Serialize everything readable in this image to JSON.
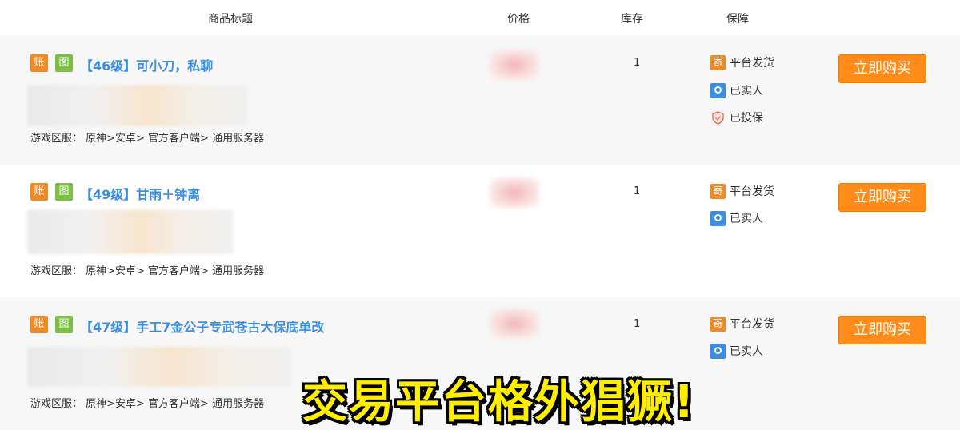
{
  "header": {
    "title": "商品标题",
    "price": "价格",
    "stock": "库存",
    "guarantee": "保障"
  },
  "tags": {
    "account": "账",
    "image": "图"
  },
  "listings": [
    {
      "title": "【46级】可小刀，私聊",
      "region": "游戏区服：  原神>安卓>  官方客户端>  通用服务器",
      "stock": "1",
      "guarantees": [
        "平台发货",
        "已实人",
        "已投保"
      ],
      "buy_label": "立即购买"
    },
    {
      "title": "【49级】甘雨＋钟离",
      "region": "游戏区服：  原神>安卓>  官方客户端>  通用服务器",
      "stock": "1",
      "guarantees": [
        "平台发货",
        "已实人"
      ],
      "buy_label": "立即购买"
    },
    {
      "title": "【47级】手工7金公子专武苍古大保底单改",
      "region": "游戏区服：  原神>安卓>  官方客户端>  通用服务器",
      "stock": "1",
      "guarantees": [
        "平台发货",
        "已实人"
      ],
      "buy_label": "立即购买"
    }
  ],
  "guarantee_icons": {
    "ship": "寄"
  },
  "overlay_caption": "交易平台格外猖獗!",
  "colors": {
    "accent_orange": "#ff8c1a",
    "title_blue": "#3a8ee6",
    "tag_green": "#7bc043",
    "caption_yellow": "#ffee00"
  }
}
